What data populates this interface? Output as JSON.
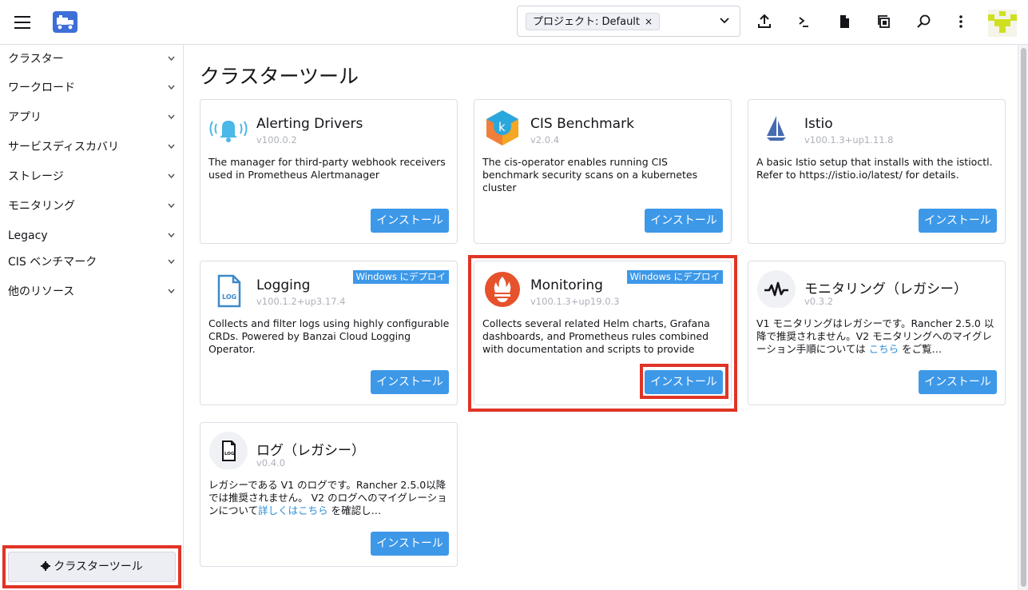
{
  "topbar": {
    "namespace_chip": "プロジェクト: Default",
    "namespace_chip_remove": "×"
  },
  "sidebar": {
    "items": [
      {
        "label": "クラスター"
      },
      {
        "label": "ワークロード"
      },
      {
        "label": "アプリ"
      },
      {
        "label": "サービスディスカバリ"
      },
      {
        "label": "ストレージ"
      },
      {
        "label": "モニタリング"
      },
      {
        "label": "Legacy"
      },
      {
        "label": "CIS ベンチマーク"
      },
      {
        "label": "他のリソース"
      }
    ],
    "cluster_tools_button": "クラスターツール"
  },
  "main": {
    "title": "クラスターツール",
    "install_label": "インストール",
    "windows_badge": "Windows にデプロイ",
    "cards": [
      {
        "name": "Alerting Drivers",
        "version": "v100.0.2",
        "icon": "bell-icon",
        "description": "The manager for third-party webhook receivers used in Prometheus Alertmanager"
      },
      {
        "name": "CIS Benchmark",
        "version": "v2.0.4",
        "icon": "cis-benchmark-icon",
        "description": "The cis-operator enables running CIS benchmark security scans on a kubernetes cluster"
      },
      {
        "name": "Istio",
        "version": "v100.1.3+up1.11.8",
        "icon": "istio-sail-icon",
        "description": "A basic Istio setup that installs with the istioctl. Refer to https://istio.io/latest/ for details."
      },
      {
        "name": "Logging",
        "version": "v100.1.2+up3.17.4",
        "icon": "log-file-icon",
        "description": "Collects and filter logs using highly configurable CRDs. Powered by Banzai Cloud Logging Operator."
      },
      {
        "name": "Monitoring",
        "version": "v100.1.3+up19.0.3",
        "icon": "prometheus-icon",
        "description": "Collects several related Helm charts, Grafana dashboards, and Prometheus rules combined with documentation and scripts to provide easy…"
      },
      {
        "name": "モニタリング（レガシー）",
        "version": "v0.3.2",
        "icon": "waveform-icon",
        "description_before": "V1 モニタリングはレガシーです。Rancher 2.5.0 以降で推奨されません。V2 モニタリングへのマイグレーション手順については ",
        "description_link": "こちら",
        "description_after": " をご覧…"
      },
      {
        "name": "ログ（レガシー）",
        "version": "v0.4.0",
        "icon": "log-doc-icon",
        "description_before": "レガシーである V1 のログです。Rancher 2.5.0以降では推奨されません。 V2 のログへのマイグレーションについて",
        "description_link": "詳しくはこちら",
        "description_after": " を確認し…"
      }
    ]
  },
  "colors": {
    "accent": "#3d98e8",
    "highlight": "#e03425",
    "brand": "#3d6fd6"
  }
}
